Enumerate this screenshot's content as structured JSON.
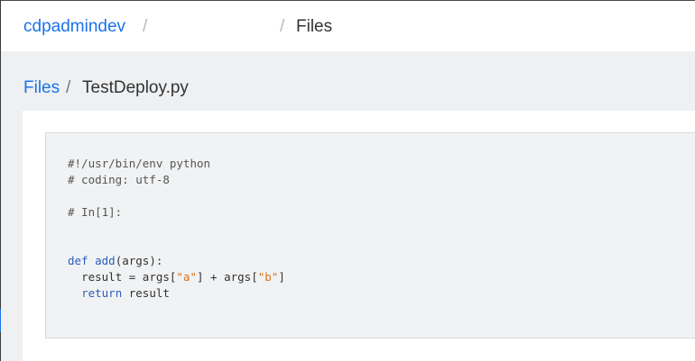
{
  "header": {
    "breadcrumb_root": "cdpadmindev",
    "separator": "/",
    "breadcrumb_current": "Files"
  },
  "subheader": {
    "breadcrumb_files": "Files",
    "separator": "/",
    "file_name": "TestDeploy.py"
  },
  "code": {
    "line1": "#!/usr/bin/env python",
    "line2": "# coding: utf-8",
    "line3": "# In[1]:",
    "def_kw": "def",
    "func_name": "add",
    "def_rest": "(args):",
    "result_lhs": "result = args[",
    "str_a": "\"a\"",
    "plus_part": "] + args[",
    "str_b": "\"b\"",
    "close_bracket": "]",
    "return_kw": "return",
    "return_val": "result"
  },
  "colors": {
    "link": "#1a73e8",
    "keyword": "#2a5fbe",
    "string": "#d8731b",
    "code_bg": "#f1f2f3",
    "page_bg": "#eef0f2"
  }
}
